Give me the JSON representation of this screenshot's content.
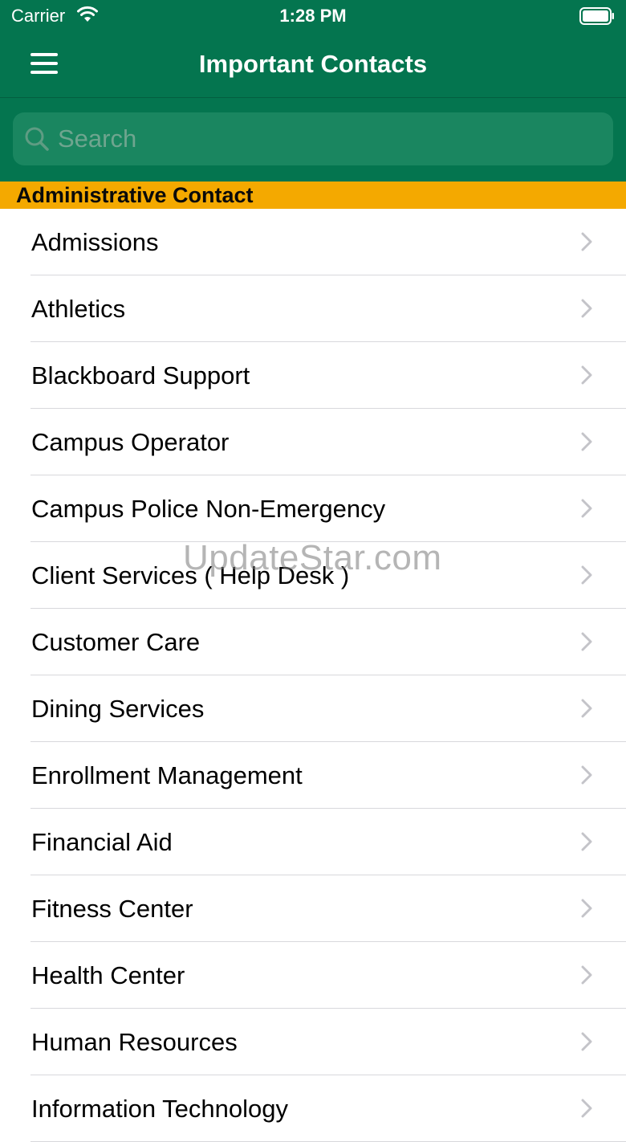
{
  "status_bar": {
    "carrier": "Carrier",
    "time": "1:28 PM"
  },
  "nav": {
    "title": "Important Contacts",
    "menu_icon": "hamburger-menu-icon"
  },
  "search": {
    "placeholder": "Search",
    "value": ""
  },
  "section": {
    "title": "Administrative Contact"
  },
  "contacts": [
    "Admissions",
    "Athletics",
    "Blackboard Support",
    "Campus Operator",
    "Campus Police Non-Emergency",
    "Client Services ( Help Desk )",
    "Customer Care",
    "Dining Services",
    "Enrollment Management",
    "Financial Aid",
    "Fitness Center",
    "Health Center",
    "Human Resources",
    "Information Technology"
  ],
  "watermark": "UpdateStar.com",
  "colors": {
    "brand_green": "#04754f",
    "section_gold": "#f4a900"
  }
}
